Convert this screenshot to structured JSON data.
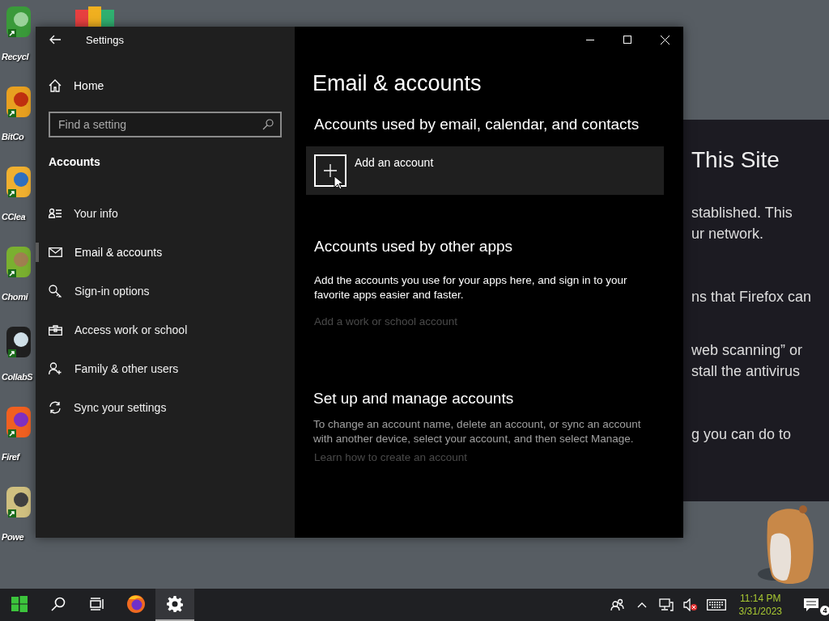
{
  "desktop": {
    "icons": [
      {
        "label": "Recycl"
      },
      {
        "label": "BitCo"
      },
      {
        "label": "CClea"
      },
      {
        "label": "Chomi"
      },
      {
        "label": "CollabS"
      },
      {
        "label": "Firef"
      },
      {
        "label": "Powe"
      }
    ]
  },
  "background_window": {
    "heading": "This Site",
    "lines": [
      "stablished. This",
      "ur network.",
      "ns that Firefox can",
      "web scanning” or",
      "stall the antivirus",
      "g you can do to"
    ]
  },
  "settings_window": {
    "title": "Settings",
    "sidebar": {
      "home": "Home",
      "search": {
        "placeholder": "Find a setting"
      },
      "section": "Accounts",
      "items": [
        {
          "label": "Your info",
          "selected": false
        },
        {
          "label": "Email & accounts",
          "selected": true
        },
        {
          "label": "Sign-in options",
          "selected": false
        },
        {
          "label": "Access work or school",
          "selected": false
        },
        {
          "label": "Family & other users",
          "selected": false
        },
        {
          "label": "Sync your settings",
          "selected": false
        }
      ]
    },
    "content": {
      "title": "Email & accounts",
      "sections": [
        {
          "heading": "Accounts used by email, calendar, and contacts",
          "add_button": "Add an account"
        },
        {
          "heading": "Accounts used by other apps",
          "text": "Add the accounts you use for your apps here, and sign in to your favorite apps easier and faster.",
          "link": {
            "label": "Add a work or school account",
            "disabled": true
          }
        },
        {
          "heading": "Set up and manage accounts",
          "text": "To change an account name, delete an account, or sync an account with another device, select your account, and then select Manage.",
          "link": {
            "label": "Learn how to create an account",
            "disabled": true
          }
        }
      ]
    }
  },
  "taskbar": {
    "apps": [
      {
        "selected": false
      },
      {
        "selected": false
      },
      {
        "selected": false
      },
      {
        "selected": false
      },
      {
        "selected": true
      }
    ],
    "time": "11:14 PM",
    "date": "3/31/2023",
    "notification_count": "4"
  }
}
